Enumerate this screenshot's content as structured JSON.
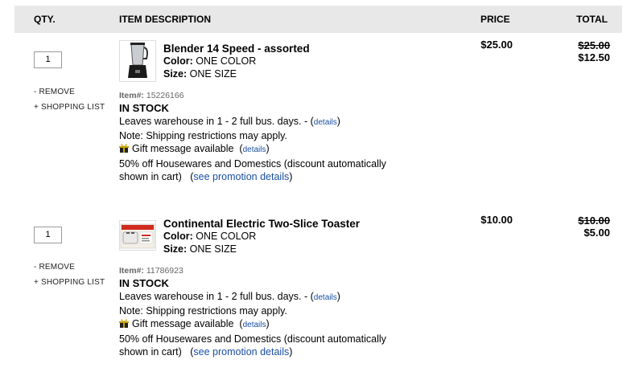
{
  "header": {
    "qty": "QTY.",
    "description": "ITEM DESCRIPTION",
    "price": "PRICE",
    "total": "TOTAL"
  },
  "items": [
    {
      "qty": "1",
      "remove": "- REMOVE",
      "shopping_list": "+ SHOPPING LIST",
      "thumb_icon": "blender-image",
      "title": "Blender 14 Speed - assorted",
      "color_label": "Color:",
      "color_value": "ONE COLOR",
      "size_label": "Size:",
      "size_value": "ONE SIZE",
      "item_label": "Item#:",
      "item_number": "15226166",
      "stock": "IN STOCK",
      "leaves": "Leaves warehouse in 1 - 2 full bus. days. - (",
      "leaves_details": "details",
      "leaves_close": ")",
      "shipping_note": "Note: Shipping restrictions may apply.",
      "gift_icon": "gift-icon",
      "gift": "Gift message available",
      "gift_open": "(",
      "gift_details": "details",
      "gift_close": ")",
      "promo_line1": "50% off Housewares and Domestics (discount automatically",
      "promo_line2": "shown in cart)",
      "promo_open": "(",
      "promo_link": "see promotion details",
      "promo_close": ")",
      "price": "$25.00",
      "total_original": "$25.00",
      "total_sale": "$12.50"
    },
    {
      "qty": "1",
      "remove": "- REMOVE",
      "shopping_list": "+ SHOPPING LIST",
      "thumb_icon": "toaster-image",
      "title": "Continental Electric Two-Slice Toaster",
      "color_label": "Color:",
      "color_value": "ONE COLOR",
      "size_label": "Size:",
      "size_value": "ONE SIZE",
      "item_label": "Item#:",
      "item_number": "11786923",
      "stock": "IN STOCK",
      "leaves": "Leaves warehouse in 1 - 2 full bus. days. - (",
      "leaves_details": "details",
      "leaves_close": ")",
      "shipping_note": "Note: Shipping restrictions may apply.",
      "gift_icon": "gift-icon",
      "gift": "Gift message available",
      "gift_open": "(",
      "gift_details": "details",
      "gift_close": ")",
      "promo_line1": "50% off Housewares and Domestics (discount automatically",
      "promo_line2": "shown in cart)",
      "promo_open": "(",
      "promo_link": "see promotion details",
      "promo_close": ")",
      "price": "$10.00",
      "total_original": "$10.00",
      "total_sale": "$5.00"
    }
  ],
  "colors": {
    "link": "#1a4fa3",
    "header_bg": "#e8e8e8"
  }
}
